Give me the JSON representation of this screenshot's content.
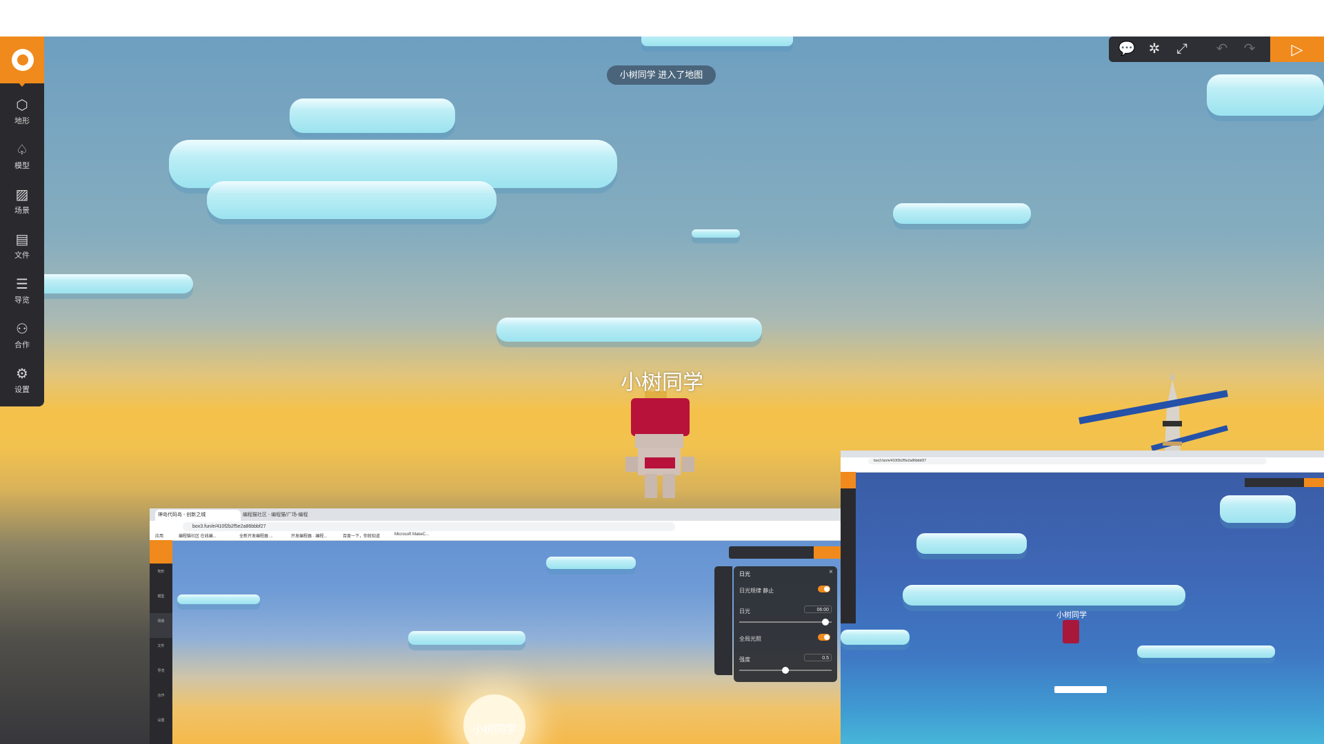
{
  "toast": "小树同学 进入了地图",
  "player_name": "小树同学",
  "sidebar": {
    "items": [
      {
        "label": "地形",
        "icon": "cube-icon"
      },
      {
        "label": "模型",
        "icon": "bell-icon"
      },
      {
        "label": "场景",
        "icon": "image-icon"
      },
      {
        "label": "文件",
        "icon": "file-icon"
      },
      {
        "label": "导览",
        "icon": "list-icon"
      },
      {
        "label": "合作",
        "icon": "users-icon"
      },
      {
        "label": "设置",
        "icon": "gear-icon"
      }
    ]
  },
  "toolbar": {
    "buttons": [
      "comment-icon",
      "bug-icon",
      "fullscreen-icon",
      "undo-icon",
      "redo-icon",
      "play-icon"
    ]
  },
  "screenshot_left": {
    "tabs": [
      "神岛代码岛 - 创新之城",
      "编程猫社区 - 编程猫/广场-编程"
    ],
    "url": "box3.fun/e/410f2b2f5e2a86bbbf27",
    "bookmarks": [
      "应用",
      "编程猫社区 在线编...",
      "全新开发编程器 ...",
      "开发编程器 · 编程...",
      "百度一下，你就知道",
      "Microsoft MakeC..."
    ],
    "sidebar_labels": [
      "地形",
      "模型",
      "场景",
      "文件",
      "导览",
      "合作",
      "设置"
    ],
    "player_name": "小树同学",
    "panel": {
      "title": "日光",
      "rows": [
        {
          "label": "日光规律 静止",
          "type": "toggle"
        },
        {
          "label": "日光",
          "type": "slider",
          "value": "06:00"
        },
        {
          "label": "全局光照",
          "type": "toggle"
        },
        {
          "label": "强度",
          "type": "slider",
          "value": "0.5"
        }
      ]
    }
  },
  "screenshot_right": {
    "url": "box3.fun/e/410f2b2f5e2a86bbbf27",
    "player_name": "小树同学"
  }
}
